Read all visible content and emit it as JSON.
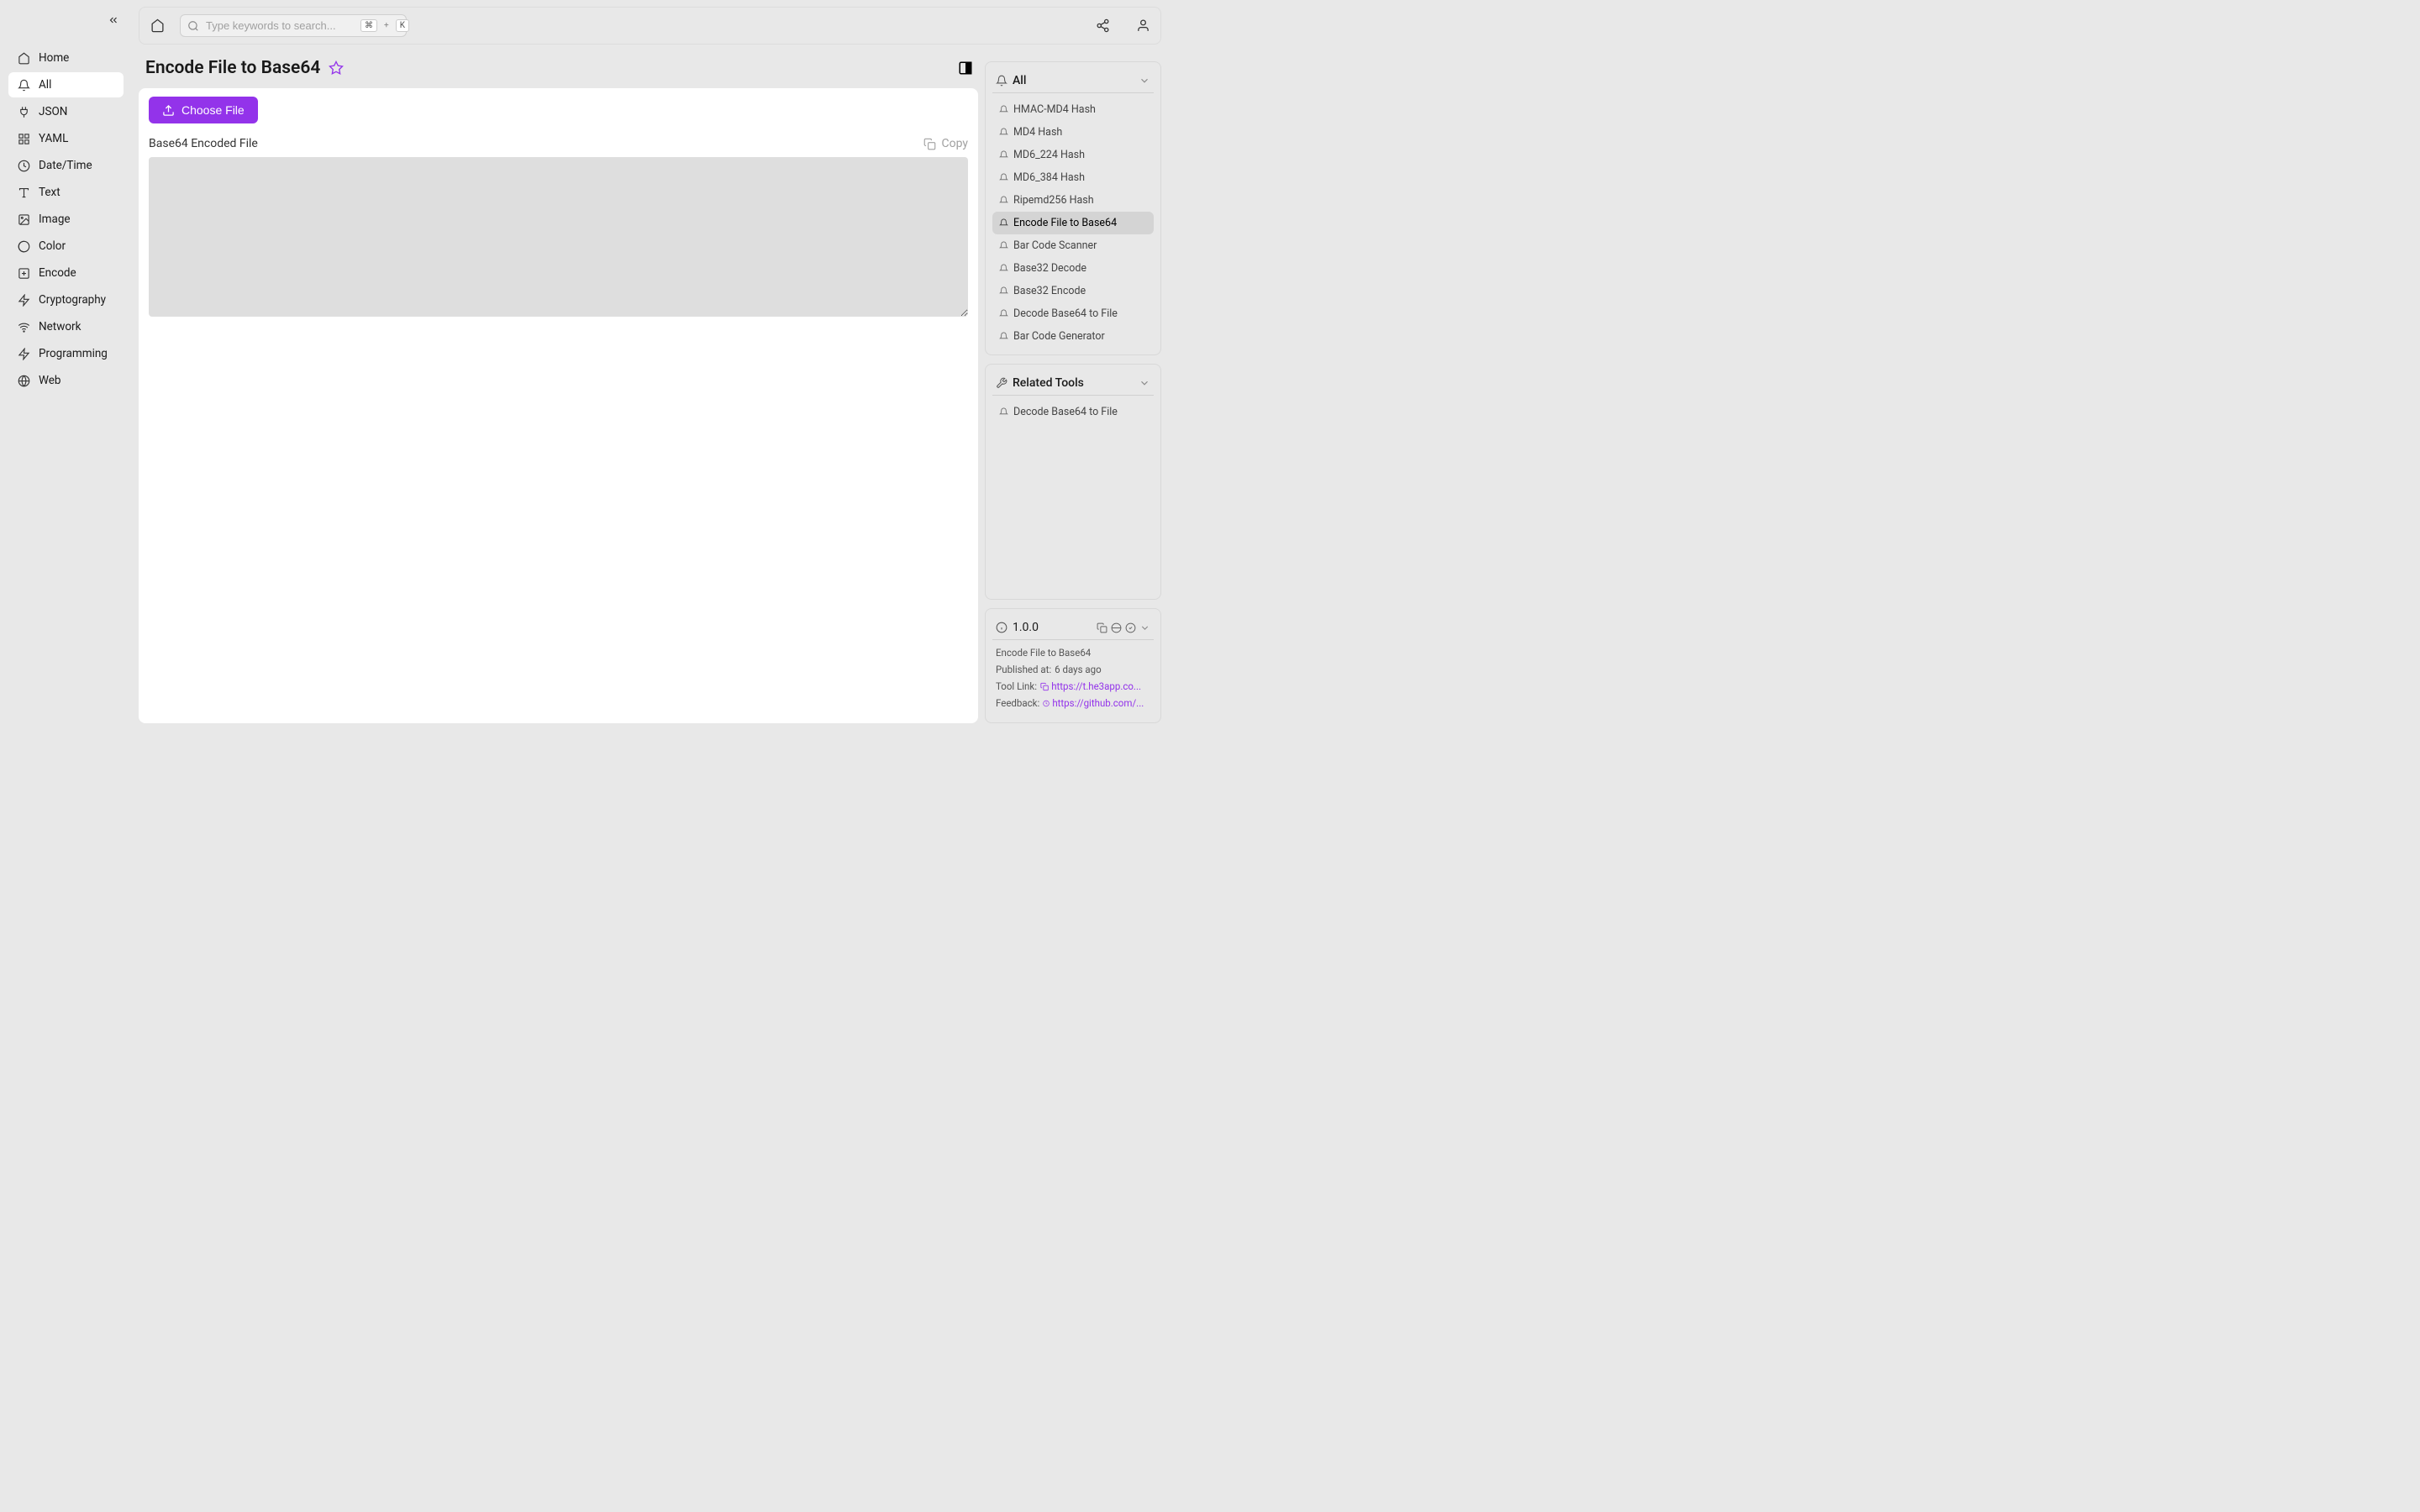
{
  "sidebar": {
    "items": [
      {
        "label": "Home"
      },
      {
        "label": "All"
      },
      {
        "label": "JSON"
      },
      {
        "label": "YAML"
      },
      {
        "label": "Date/Time"
      },
      {
        "label": "Text"
      },
      {
        "label": "Image"
      },
      {
        "label": "Color"
      },
      {
        "label": "Encode"
      },
      {
        "label": "Cryptography"
      },
      {
        "label": "Network"
      },
      {
        "label": "Programming"
      },
      {
        "label": "Web"
      }
    ],
    "active_index": 1
  },
  "topbar": {
    "search_placeholder": "Type keywords to search...",
    "kbd1": "⌘",
    "kbd_plus": "+",
    "kbd2": "K"
  },
  "page": {
    "title": "Encode File to Base64"
  },
  "tool": {
    "choose_file_label": "Choose File",
    "output_label": "Base64 Encoded File",
    "copy_label": "Copy"
  },
  "right_panel": {
    "all_label": "All",
    "tools": [
      {
        "label": "HMAC-MD4 Hash"
      },
      {
        "label": "MD4 Hash"
      },
      {
        "label": "MD6_224 Hash"
      },
      {
        "label": "MD6_384 Hash"
      },
      {
        "label": "Ripemd256 Hash"
      },
      {
        "label": "Encode File to Base64"
      },
      {
        "label": "Bar Code Scanner"
      },
      {
        "label": "Base32 Decode"
      },
      {
        "label": "Base32 Encode"
      },
      {
        "label": "Decode Base64 to File"
      },
      {
        "label": "Bar Code Generator"
      }
    ],
    "active_tool_index": 5,
    "related_label": "Related Tools",
    "related": [
      {
        "label": "Decode Base64 to File"
      }
    ]
  },
  "info": {
    "version": "1.0.0",
    "name": "Encode File to Base64",
    "published_label": "Published at:",
    "published_value": "6 days ago",
    "tool_link_label": "Tool Link:",
    "tool_link_url": "https://t.he3app.co...",
    "feedback_label": "Feedback:",
    "feedback_url": "https://github.com/..."
  }
}
